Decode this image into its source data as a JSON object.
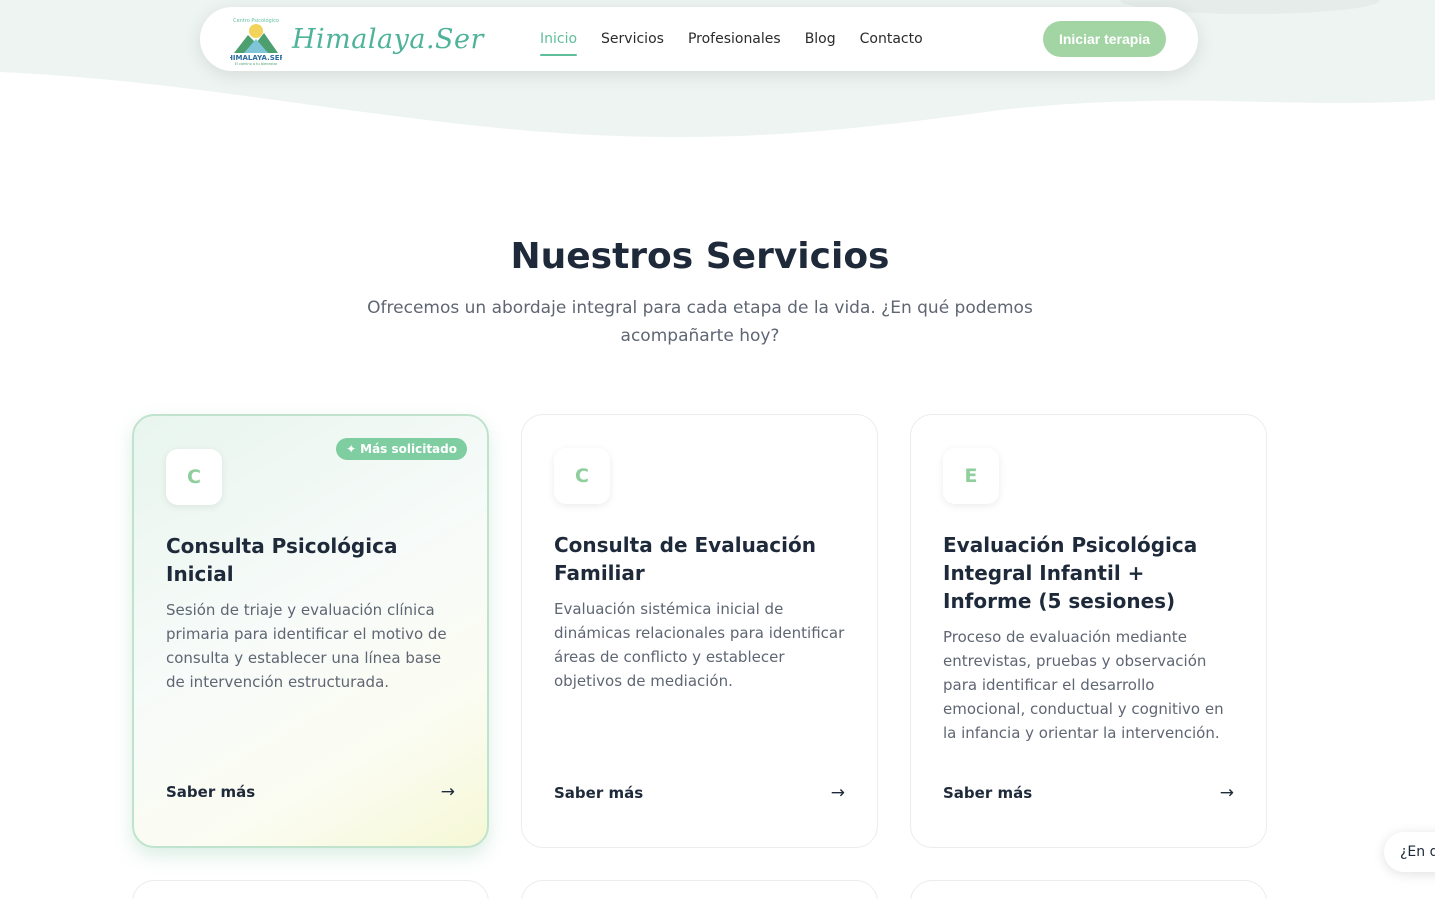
{
  "brand": {
    "logo_text": "Himalaya.Ser"
  },
  "nav": {
    "links": [
      "Inicio",
      "Servicios",
      "Profesionales",
      "Blog",
      "Contacto"
    ],
    "active": "Inicio",
    "cta_label": "Iniciar terapia"
  },
  "section": {
    "title": "Nuestros Servicios",
    "subtitle": "Ofrecemos un abordaje integral para cada etapa de la vida. ¿En qué podemos acompañarte hoy?"
  },
  "cards": [
    {
      "letter": "C",
      "badge": "Más solicitado",
      "title": "Consulta Psicológica Inicial",
      "description": "Sesión de triaje y evaluación clínica primaria para identificar el motivo de consulta y establecer una línea base de intervención estructurada.",
      "link_label": "Saber más"
    },
    {
      "letter": "C",
      "title": "Consulta de Evaluación Familiar",
      "description": "Evaluación sistémica inicial de dinámicas relacionales para identificar áreas de conflicto y establecer objetivos de mediación.",
      "link_label": "Saber más"
    },
    {
      "letter": "E",
      "title": "Evaluación Psicológica Integral Infantil + Informe (5 sesiones)",
      "description": "Proceso de evaluación mediante entrevistas, pruebas y observación para identificar el desarrollo emocional, conductual y cognitivo en la infancia y orientar la intervención.",
      "link_label": "Saber más"
    }
  ],
  "chat": {
    "label": "¿En q"
  },
  "colors": {
    "accent": "#5fbf9a",
    "cta": "#a3d4a4",
    "badge": "#7fcea1",
    "heading": "#1e2a3a"
  }
}
